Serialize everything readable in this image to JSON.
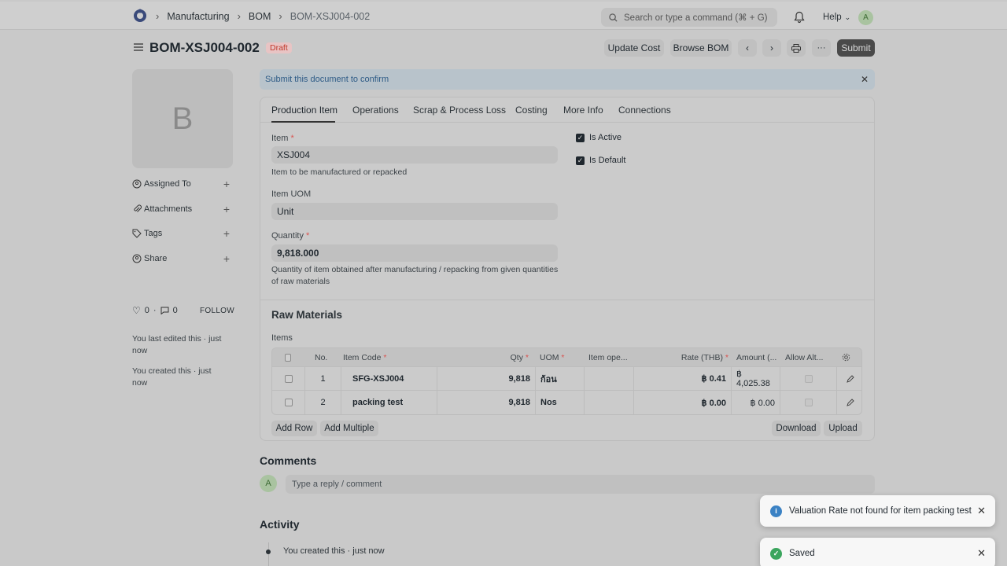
{
  "navbar": {
    "breadcrumbs": [
      "Manufacturing",
      "BOM",
      "BOM-XSJ004-002"
    ],
    "search_placeholder": "Search or type a command (⌘ + G)",
    "help_label": "Help",
    "avatar_initial": "A"
  },
  "header": {
    "title": "BOM-XSJ004-002",
    "status": "Draft",
    "buttons": {
      "update_cost": "Update Cost",
      "browse_bom": "Browse BOM",
      "submit": "Submit"
    }
  },
  "sidebar": {
    "avatar_letter": "B",
    "items": [
      {
        "label": "Assigned To"
      },
      {
        "label": "Attachments"
      },
      {
        "label": "Tags"
      },
      {
        "label": "Share"
      }
    ],
    "likes": "0",
    "comments": "0",
    "follow_label": "FOLLOW",
    "last_edited": "You last edited this · just now",
    "created": "You created this · just now"
  },
  "alert": {
    "text": "Submit this document to confirm"
  },
  "tabs": [
    "Production Item",
    "Operations",
    "Scrap & Process Loss",
    "Costing",
    "More Info",
    "Connections"
  ],
  "form": {
    "item_label": "Item",
    "item_value": "XSJ004",
    "item_help": "Item to be manufactured or repacked",
    "uom_label": "Item UOM",
    "uom_value": "Unit",
    "qty_label": "Quantity",
    "qty_value": "9,818.000",
    "qty_help": "Quantity of item obtained after manufacturing / repacking from given quantities of raw materials",
    "is_active_label": "Is Active",
    "is_default_label": "Is Default"
  },
  "raw_materials": {
    "title": "Raw Materials",
    "items_label": "Items",
    "columns": {
      "no": "No.",
      "item_code": "Item Code",
      "qty": "Qty",
      "uom": "UOM",
      "item_op": "Item ope...",
      "rate": "Rate (THB)",
      "amount": "Amount (...",
      "allow_alt": "Allow Alt..."
    },
    "rows": [
      {
        "no": "1",
        "item_code": "SFG-XSJ004",
        "qty": "9,818",
        "uom": "ก้อน",
        "item_op": "",
        "rate": "฿ 0.41",
        "amount": "฿ 4,025.38"
      },
      {
        "no": "2",
        "item_code": "packing test",
        "qty": "9,818",
        "uom": "Nos",
        "item_op": "",
        "rate": "฿ 0.00",
        "amount": "฿ 0.00"
      }
    ],
    "buttons": {
      "add_row": "Add Row",
      "add_multiple": "Add Multiple",
      "download": "Download",
      "upload": "Upload"
    }
  },
  "comments": {
    "title": "Comments",
    "avatar_initial": "A",
    "placeholder": "Type a reply / comment"
  },
  "activity": {
    "title": "Activity",
    "entry": "You created this · just now"
  },
  "toasts": [
    {
      "text": "Valuation Rate not found for item packing test",
      "kind": "info"
    },
    {
      "text": "Saved",
      "kind": "success"
    }
  ],
  "colors": {
    "draft_badge": "#c0392b",
    "info_toast_icon": "#3b82c4",
    "success_toast_icon": "#3aa55d"
  }
}
